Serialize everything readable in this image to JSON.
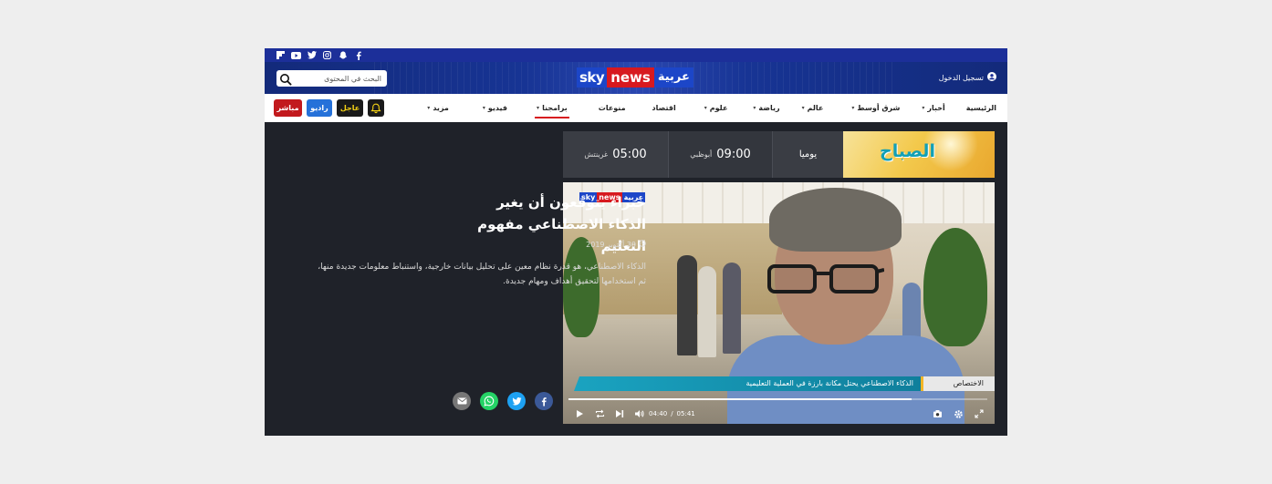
{
  "header": {
    "login_label": "تسجيل الدخول",
    "search_placeholder": "البحث في المحتوى",
    "logo": {
      "sky": "sky",
      "news": "news",
      "arabic": "عربية"
    }
  },
  "social_icons": [
    "flipboard-icon",
    "youtube-icon",
    "twitter-icon",
    "instagram-icon",
    "snapchat-icon",
    "facebook-icon"
  ],
  "nav": {
    "items": [
      {
        "label": "الرئيسية",
        "has_dropdown": false,
        "active": false
      },
      {
        "label": "أخبار",
        "has_dropdown": true,
        "active": false
      },
      {
        "label": "شرق أوسط",
        "has_dropdown": true,
        "active": false
      },
      {
        "label": "عالم",
        "has_dropdown": true,
        "active": false
      },
      {
        "label": "رياضة",
        "has_dropdown": true,
        "active": false
      },
      {
        "label": "علوم",
        "has_dropdown": true,
        "active": false
      },
      {
        "label": "اقتصاد",
        "has_dropdown": false,
        "active": false
      },
      {
        "label": "منوعات",
        "has_dropdown": false,
        "active": false
      },
      {
        "label": "برامجنا",
        "has_dropdown": true,
        "active": true
      },
      {
        "label": "فيديو",
        "has_dropdown": true,
        "active": false
      },
      {
        "label": "مزيد",
        "has_dropdown": true,
        "active": false
      }
    ],
    "buttons": {
      "live": "مباشر",
      "radio": "راديو",
      "breaking": "عاجل"
    }
  },
  "schedule": {
    "program_logo_text": "الصباح",
    "frequency": "يوميا",
    "abu_dhabi_time": "09:00",
    "abu_dhabi_label": "أبوظبي",
    "gmt_time": "05:00",
    "gmt_label": "غرينتش"
  },
  "video": {
    "overlay_logo": {
      "sky": "sky",
      "news": "news",
      "arabic": "عربية"
    },
    "caption_label": "الاختصاص",
    "caption_text": "الذكاء الاصطناعي يحتل مكانة بارزة في العملية التعليمية",
    "current_time": "04:40",
    "separator": "/",
    "duration": "05:41",
    "progress_fraction": 0.82
  },
  "article": {
    "title": "خبراء يتوقعون أن يغير الذكاء الاصطناعي مفهوم التعليم",
    "date": "30 أكتوبر 2019",
    "summary": "الذكاء الاصطناعي، هو قدرة نظام معين على تحليل بيانات خارجية، واستنباط معلومات جديدة منها، ثم استخدامها لتحقيق أهداف ومهام جديدة."
  },
  "share": [
    "email-icon",
    "whatsapp-icon",
    "twitter-icon",
    "facebook-icon"
  ],
  "colors": {
    "brand_blue": "#1c2f99",
    "brand_red": "#d7191f",
    "page_dark": "#1f2229",
    "live_red": "#c2191d",
    "radio_blue": "#2571d9",
    "breaking_yellow": "#f7d414",
    "caption_teal": "#1aa3c0",
    "facebook": "#3b5998",
    "twitter": "#1da1f2",
    "whatsapp": "#25d366",
    "email": "#777777"
  }
}
